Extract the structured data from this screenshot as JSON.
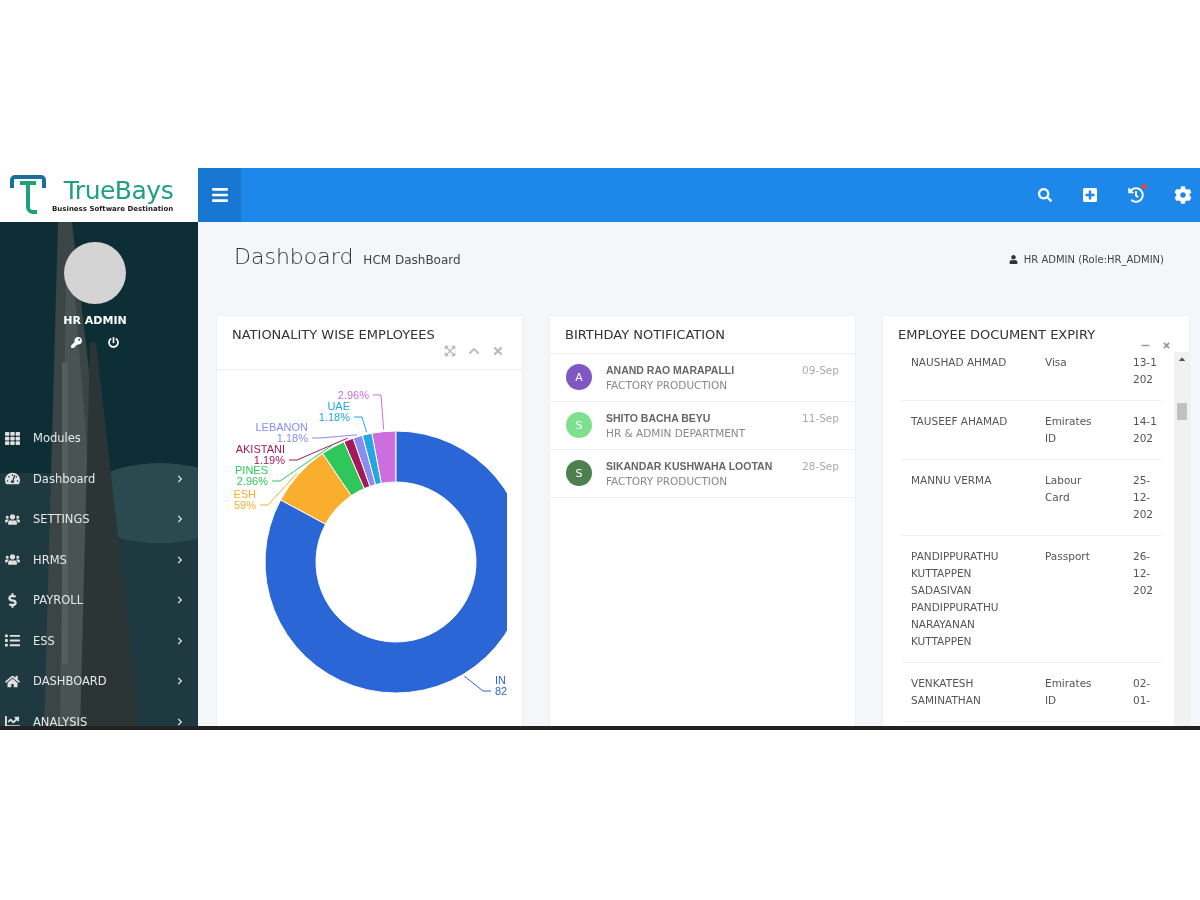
{
  "logo": {
    "name": "TrueBays",
    "tagline": "Business Software Destination"
  },
  "user": {
    "name": "HR ADMIN"
  },
  "menu": [
    {
      "label": "Modules",
      "has_submenu": false
    },
    {
      "label": "Dashboard",
      "has_submenu": true
    },
    {
      "label": "SETTINGS",
      "has_submenu": true
    },
    {
      "label": "HRMS",
      "has_submenu": true
    },
    {
      "label": "PAYROLL",
      "has_submenu": true
    },
    {
      "label": "ESS",
      "has_submenu": true
    },
    {
      "label": "DASHBOARD",
      "has_submenu": true
    },
    {
      "label": "ANALYSIS",
      "has_submenu": true
    }
  ],
  "topbar": {
    "notification": true
  },
  "page": {
    "title": "Dashboard",
    "subtitle": "HCM DashBoard",
    "user_role": "HR ADMIN (Role:HR_ADMIN)"
  },
  "nationality_card": {
    "title": "NATIONALITY WISE EMPLOYEES",
    "chart_data": {
      "type": "donut",
      "values": [
        2.96,
        1.18,
        1.18,
        1.19,
        2.96,
        7.69,
        82.84
      ],
      "colors": [
        "#cc6ee0",
        "#22a7e0",
        "#8a8cf0",
        "#a3195b",
        "#2fc75a",
        "#f9ae2e",
        "#2a66d6"
      ]
    },
    "slice_labels": [
      {
        "reading": "2.96%"
      },
      {
        "name": "UAE",
        "reading": "1.18%"
      },
      {
        "name": "LEBANON",
        "reading": "1.18%"
      },
      {
        "name": "AKISTANI",
        "reading": "1.19%"
      },
      {
        "name": "PINES",
        "reading": "2.96%"
      },
      {
        "name": "ESH",
        "reading": "59%"
      },
      {
        "name": "IN",
        "reading": "82"
      }
    ]
  },
  "birthday_card": {
    "title": "BIRTHDAY NOTIFICATION",
    "items": [
      {
        "initial": "A",
        "name": "ANAND RAO MARAPALLI",
        "department": "FACTORY PRODUCTION",
        "date": "09-Sep",
        "color": "#7e57c2"
      },
      {
        "initial": "S",
        "name": "SHITO BACHA BEYU",
        "department": "HR & ADMIN DEPARTMENT",
        "date": "11-Sep",
        "color": "#7ee08f"
      },
      {
        "initial": "S",
        "name": "SIKANDAR KUSHWAHA LOOTAN",
        "department": "FACTORY PRODUCTION",
        "date": "28-Sep",
        "color": "#4e7f4e"
      }
    ]
  },
  "expiry_card": {
    "title": "EMPLOYEE DOCUMENT EXPIRY",
    "rows": [
      {
        "name": "NAUSHAD AHMAD",
        "document": "Visa",
        "date": [
          "13-1",
          "202"
        ]
      },
      {
        "name": "TAUSEEF AHAMAD",
        "document": "Emirates ID",
        "date": [
          "14-1",
          "202"
        ]
      },
      {
        "name": "MANNU VERMA",
        "document": "Labour Card",
        "date": [
          "25-",
          "12-",
          "202"
        ]
      },
      {
        "name": "PANDIPPURATHU KUTTAPPEN SADASIVAN PANDIPPURATHU NARAYANAN KUTTAPPEN",
        "document": "Passport",
        "date": [
          "26-",
          "12-",
          "202"
        ]
      },
      {
        "name": "VENKATESH SAMINATHAN",
        "document": "Emirates ID",
        "date": [
          "02-",
          "01-"
        ]
      }
    ]
  }
}
